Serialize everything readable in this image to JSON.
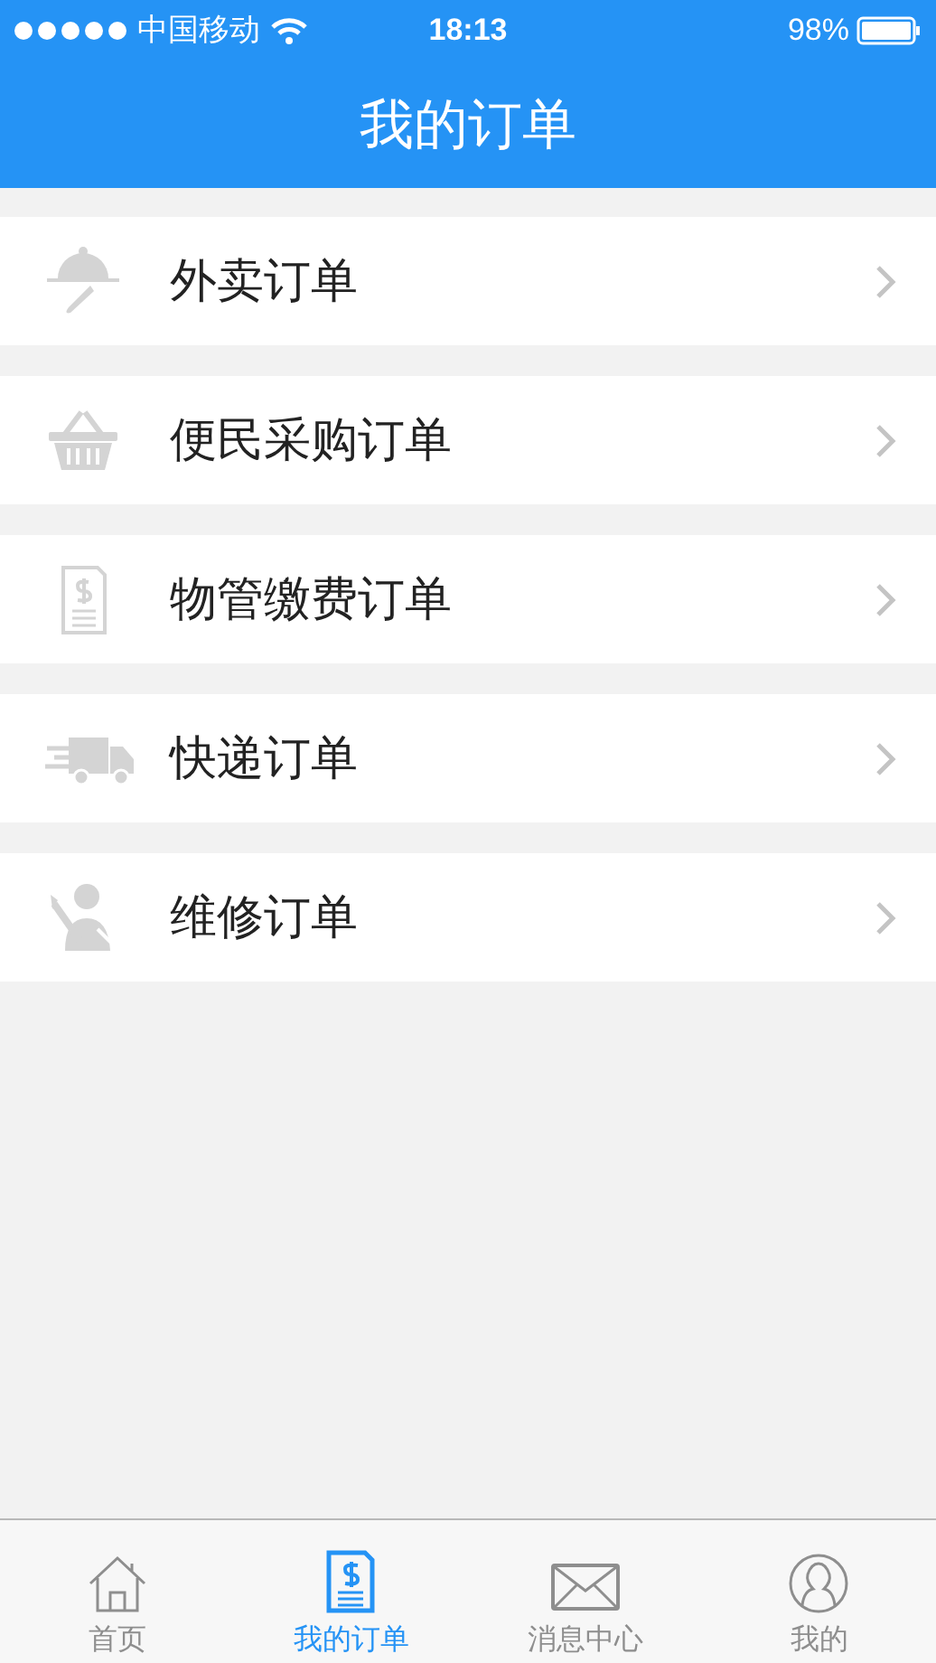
{
  "status_bar": {
    "carrier": "中国移动",
    "time": "18:13",
    "battery": "98%"
  },
  "header": {
    "title": "我的订单"
  },
  "orders": [
    {
      "kind": "takeout",
      "label": "外卖订单"
    },
    {
      "kind": "basket",
      "label": "便民采购订单"
    },
    {
      "kind": "bill",
      "label": "物管缴费订单"
    },
    {
      "kind": "truck",
      "label": "快递订单"
    },
    {
      "kind": "repair",
      "label": "维修订单"
    }
  ],
  "tab_bar": [
    {
      "kind": "home",
      "label": "首页",
      "selected": false
    },
    {
      "kind": "bill",
      "label": "我的订单",
      "selected": true
    },
    {
      "kind": "mail",
      "label": "消息中心",
      "selected": false
    },
    {
      "kind": "user",
      "label": "我的",
      "selected": false
    }
  ]
}
